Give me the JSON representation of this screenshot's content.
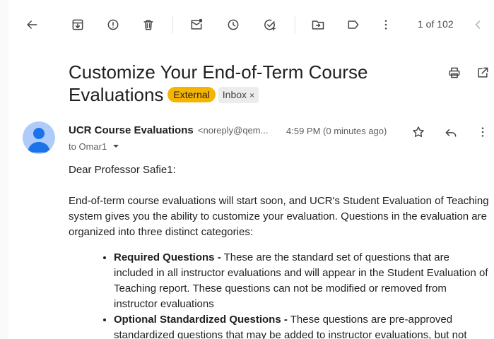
{
  "toolbar": {
    "icons": [
      "back-arrow-icon",
      "archive-icon",
      "report-spam-icon",
      "delete-icon",
      "mark-unread-icon",
      "snooze-icon",
      "add-task-icon",
      "move-to-icon",
      "label-icon",
      "more-vert-icon",
      "chevron-left-icon"
    ],
    "pager": "1 of 102"
  },
  "email": {
    "subject": "Customize Your End-of-Term Course Evaluations",
    "labels": {
      "external": "External",
      "inbox": "Inbox",
      "inbox_close": "×"
    },
    "sender_name": "UCR Course Evaluations",
    "sender_email": "<noreply@qem...",
    "time": "4:59 PM (0 minutes ago)",
    "to": "to Omar1",
    "greeting": "Dear Professor Safie1:",
    "paragraph1": "End-of-term course evaluations will start soon, and UCR's Student Evaluation of Teaching system gives you the ability to customize your evaluation. Questions in the evaluation are organized into three distinct categories:",
    "bullets": [
      {
        "title": "Required Questions -",
        "text": " These are the standard set of questions that are included in all instructor evaluations and will appear in the Student Evaluation of Teaching report. These questions can not be modified or removed from instructor evaluations"
      },
      {
        "title": "Optional Standardized Questions -",
        "text": " These questions are pre-approved standardized questions that may be added to instructor evaluations, but not"
      }
    ]
  },
  "colors": {
    "external_chip": "#f6b300",
    "inbox_chip": "#ececec",
    "avatar_bg": "#aecbfa",
    "avatar_fg": "#1a73e8"
  }
}
